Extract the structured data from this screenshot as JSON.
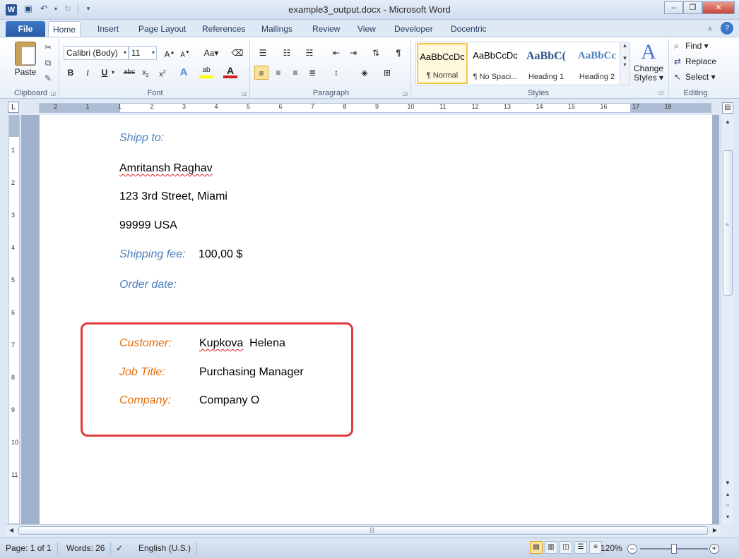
{
  "window": {
    "title": "example3_output.docx - Microsoft Word"
  },
  "tabs": [
    {
      "label": "File"
    },
    {
      "label": "Home"
    },
    {
      "label": "Insert"
    },
    {
      "label": "Page Layout"
    },
    {
      "label": "References"
    },
    {
      "label": "Mailings"
    },
    {
      "label": "Review"
    },
    {
      "label": "View"
    },
    {
      "label": "Developer"
    },
    {
      "label": "Docentric"
    }
  ],
  "ribbon": {
    "clipboard": {
      "label": "Clipboard",
      "paste": "Paste"
    },
    "font": {
      "label": "Font",
      "family": "Calibri (Body)",
      "size": "11"
    },
    "paragraph": {
      "label": "Paragraph"
    },
    "styles": {
      "label": "Styles",
      "items": [
        {
          "preview": "AaBbCcDc",
          "name": "¶ Normal"
        },
        {
          "preview": "AaBbCcDc",
          "name": "¶ No Spaci..."
        },
        {
          "preview": "AaBbC(",
          "name": "Heading 1"
        },
        {
          "preview": "AaBbCc",
          "name": "Heading 2"
        }
      ],
      "change_styles_line1": "Change",
      "change_styles_line2": "Styles ▾"
    },
    "editing": {
      "label": "Editing",
      "find": "Find ▾",
      "replace": "Replace",
      "select": "Select ▾"
    }
  },
  "ruler": {
    "numbers": [
      "2",
      "1",
      "1",
      "2",
      "3",
      "4",
      "5",
      "6",
      "7",
      "8",
      "9",
      "10",
      "11",
      "12",
      "13",
      "14",
      "15",
      "16",
      "17",
      "18"
    ]
  },
  "vruler": {
    "numbers": [
      "1",
      "2",
      "3",
      "4",
      "5",
      "6",
      "7",
      "8",
      "9",
      "10",
      "11"
    ]
  },
  "document": {
    "ship_to_label": "Shipp to:",
    "ship_name": "Amritansh Raghav",
    "ship_address": "123 3rd Street, Miami",
    "ship_zip_country": "99999  USA",
    "shipping_fee_label": "Shipping fee:",
    "shipping_fee_value": "100,00 $",
    "order_date_label": "Order date:",
    "customer_label": "Customer:",
    "customer_last": "Kupkova",
    "customer_first": "Helena",
    "job_title_label": "Job Title:",
    "job_title_value": "Purchasing Manager",
    "company_label": "Company:",
    "company_value": "Company O"
  },
  "statusbar": {
    "page": "Page: 1 of 1",
    "words": "Words: 26",
    "language": "English (U.S.)",
    "zoom": "120%"
  },
  "colors": {
    "label_blue": "#4f81bd",
    "label_orange": "#e36c0a",
    "highlight_box": "#e23b3b"
  }
}
